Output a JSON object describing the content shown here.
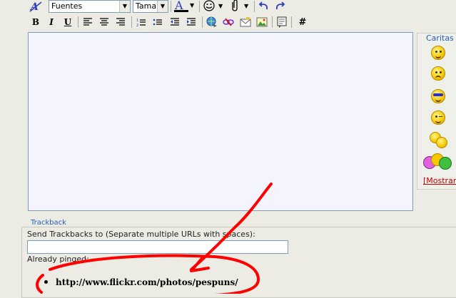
{
  "toolbar": {
    "font_select": "Fuentes",
    "size_select": "Tamai",
    "buttons_row1": [
      "font-style-icon",
      "text-color-icon",
      "smiley-icon",
      "attach-icon",
      "undo-icon",
      "redo-icon"
    ],
    "buttons_row2": [
      "bold",
      "italic",
      "underline",
      "align-left",
      "align-center",
      "align-right",
      "ordered-list",
      "unordered-list",
      "outdent",
      "indent",
      "link",
      "unlink",
      "email",
      "image",
      "quote",
      "hash"
    ],
    "bold_label": "B",
    "italic_label": "I",
    "underline_label": "U",
    "hash_label": "#",
    "color_label": "A"
  },
  "smilies": {
    "title": "Caritas",
    "more_link": "[Mostrar"
  },
  "trackback": {
    "legend": "Trackback",
    "send_label": "Send Trackbacks to (Separate multiple URLs with spaces):",
    "input_value": "",
    "pinged_label": "Already pinged:",
    "pinged_items": [
      "http://www.flickr.com/photos/pespuns/"
    ]
  },
  "colors": {
    "background": "#ecebe4",
    "editor_bg": "#f4f4ff",
    "accent_blue": "#1f5fbf",
    "annotation_red": "#ff0000"
  }
}
